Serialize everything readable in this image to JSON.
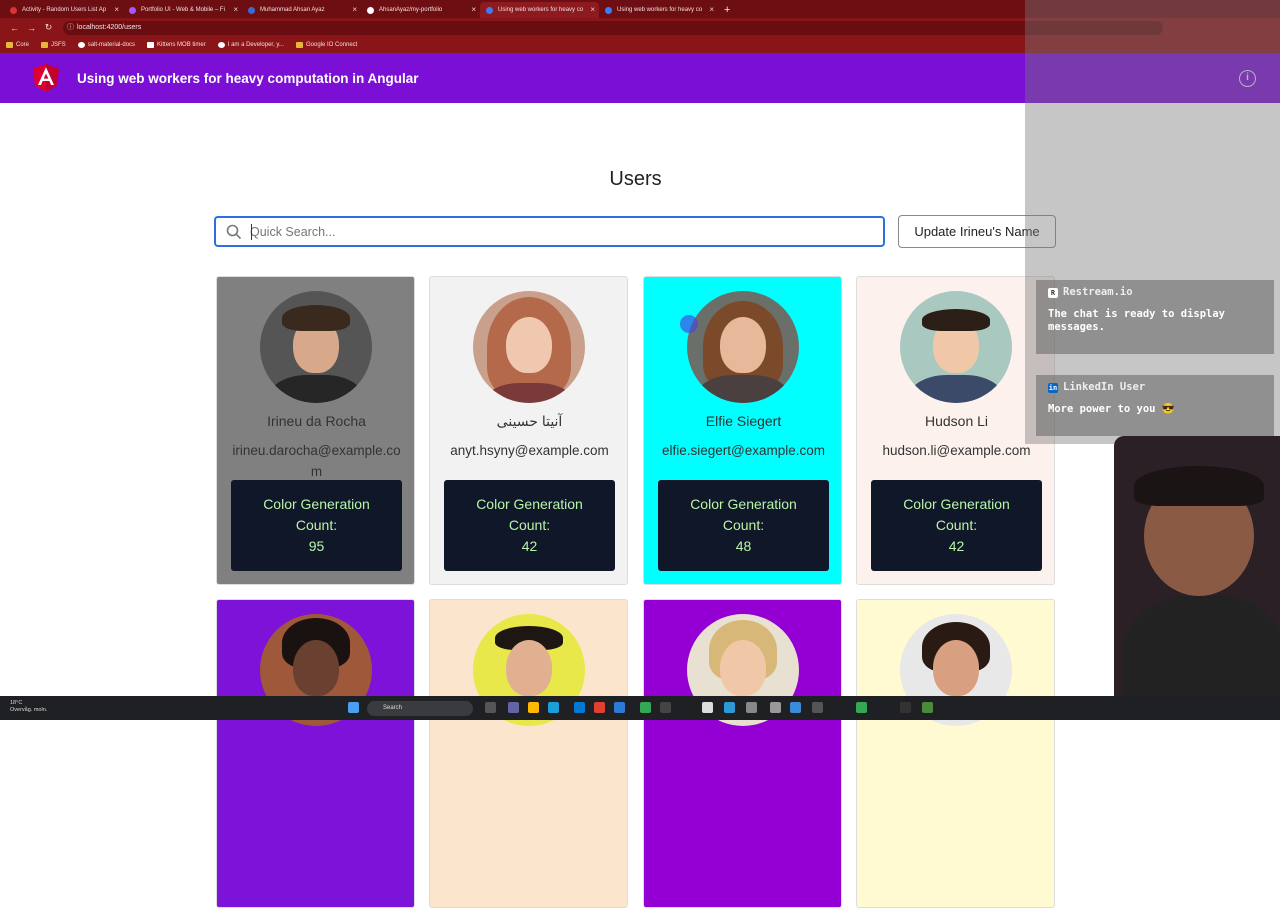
{
  "browser": {
    "tabs": [
      {
        "title": "Activity - Random Users List Ap",
        "active": false
      },
      {
        "title": "Portfolio UI - Web & Mobile – Fi",
        "active": false
      },
      {
        "title": "Muhammad Ahsan Ayaz",
        "active": false
      },
      {
        "title": "AhsanAyaz/my-portfolio",
        "active": false
      },
      {
        "title": "Using web workers for heavy co",
        "active": true
      },
      {
        "title": "Using web workers for heavy co",
        "active": false
      }
    ],
    "new_tab": "+",
    "url": "localhost:4200/users",
    "bookmarks": [
      "Core",
      "JSFS",
      "salt-material-docs",
      "Kittens MOB timer",
      "I am a Developer, y...",
      "Google IO Connect"
    ]
  },
  "app": {
    "title": "Using web workers for heavy computation in Angular",
    "info_icon": "i",
    "page_title": "Users",
    "search_placeholder": "Quick Search...",
    "update_button": "Update Irineu's Name",
    "count_label": "Color Generation Count:"
  },
  "users": [
    {
      "name": "Irineu da Rocha",
      "email": "irineu.darocha@example.com",
      "count": "95",
      "bg": "#808080"
    },
    {
      "name": "آنیتا حسینی",
      "email": "anyt.hsyny@example.com",
      "count": "42",
      "bg": "#f2f2f2"
    },
    {
      "name": "Elfie Siegert",
      "email": "elfie.siegert@example.com",
      "count": "48",
      "bg": "#00ffff"
    },
    {
      "name": "Hudson Li",
      "email": "hudson.li@example.com",
      "count": "42",
      "bg": "#fdf1ee"
    },
    {
      "bg": "#7d12d9"
    },
    {
      "bg": "#fce5cd"
    },
    {
      "bg": "#9400d3"
    },
    {
      "bg": "#fffad2"
    }
  ],
  "chat": [
    {
      "source": "Restream.io",
      "message": "The chat is ready to display messages."
    },
    {
      "source": "LinkedIn User",
      "message": "More power to you 😎"
    }
  ],
  "taskbar": {
    "weather_temp": "18°C",
    "weather_desc": "Overvåg. moln.",
    "search": "Search"
  }
}
